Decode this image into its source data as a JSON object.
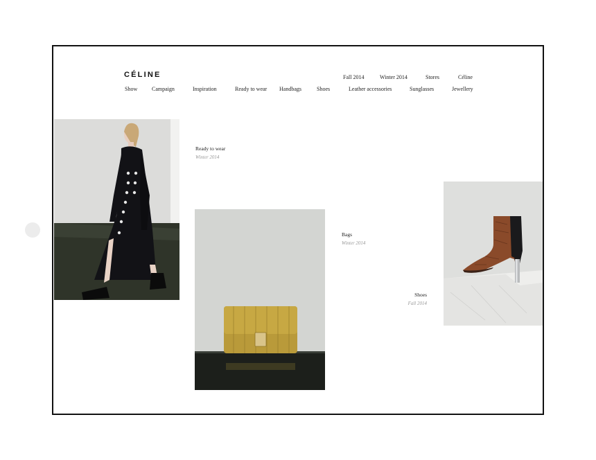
{
  "brand": {
    "logo": "CÉLINE"
  },
  "top_nav": [
    "Fall 2014",
    "Winter 2014",
    "Stores",
    "Céline"
  ],
  "main_nav": [
    "Show",
    "Campaign",
    "Inspiration",
    "Ready to wear",
    "Handbags",
    "Shoes",
    "Leather accessories",
    "Sunglasses",
    "Jewellery"
  ],
  "sections": {
    "ready_to_wear": {
      "title": "Ready to wear",
      "season": "Winter 2014"
    },
    "bags": {
      "title": "Bags",
      "season": "Winter 2014"
    },
    "shoes": {
      "title": "Shoes",
      "season": "Fall 2014"
    }
  },
  "colors": {
    "frame": "#111111",
    "bag": "#b99a3a",
    "boot": "#8a4a2a",
    "coat": "#121216"
  }
}
